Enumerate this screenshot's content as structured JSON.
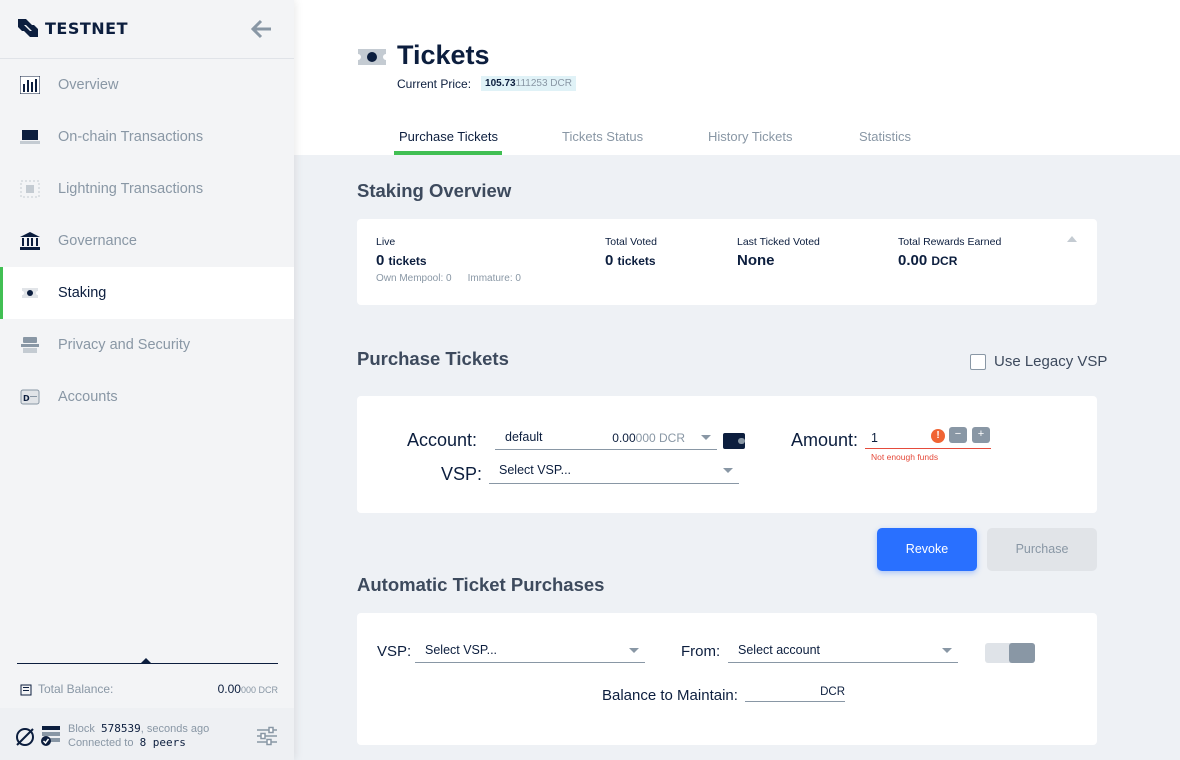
{
  "app": {
    "brand": "TESTNET"
  },
  "sidebar": {
    "items": [
      {
        "label": "Overview",
        "icon": "overview-icon"
      },
      {
        "label": "On-chain Transactions",
        "icon": "transactions-icon"
      },
      {
        "label": "Lightning Transactions",
        "icon": "lightning-icon"
      },
      {
        "label": "Governance",
        "icon": "governance-icon"
      },
      {
        "label": "Staking",
        "icon": "staking-icon",
        "active": true
      },
      {
        "label": "Privacy and Security",
        "icon": "privacy-icon"
      },
      {
        "label": "Accounts",
        "icon": "accounts-icon"
      }
    ],
    "total_balance_label": "Total Balance:",
    "total_balance_main": "0.00",
    "total_balance_small": "000 DCR",
    "footer": {
      "block_label": "Block",
      "block_number": "578539",
      "block_time": ", seconds ago",
      "connected_label": "Connected to",
      "peers": "8 peers"
    }
  },
  "header": {
    "title": "Tickets",
    "price_label": "Current Price:",
    "price_main": "105.73",
    "price_dim": "111253 DCR",
    "tabs": [
      "Purchase Tickets",
      "Tickets Status",
      "History Tickets",
      "Statistics"
    ],
    "active_tab": 0
  },
  "staking_overview": {
    "title": "Staking Overview",
    "live_label": "Live",
    "live_value": "0",
    "live_unit": "tickets",
    "own_mempool": "Own Mempool: 0",
    "immature": "Immature: 0",
    "total_voted_label": "Total Voted",
    "total_voted_value": "0",
    "total_voted_unit": "tickets",
    "last_voted_label": "Last Ticked Voted",
    "last_voted_value": "None",
    "rewards_label": "Total Rewards Earned",
    "rewards_value": "0.00",
    "rewards_unit": "DCR"
  },
  "purchase": {
    "title": "Purchase Tickets",
    "legacy_label": "Use Legacy VSP",
    "account_label": "Account:",
    "account_value": "default",
    "account_balance_main": "0.00",
    "account_balance_dim": "000 DCR",
    "vsp_label": "VSP:",
    "vsp_placeholder": "Select VSP...",
    "amount_label": "Amount:",
    "amount_value": "1",
    "error_text": "Not enough funds",
    "minus": "−",
    "plus": "+",
    "revoke_label": "Revoke",
    "purchase_label": "Purchase"
  },
  "auto": {
    "title": "Automatic Ticket Purchases",
    "vsp_label": "VSP:",
    "vsp_placeholder": "Select VSP...",
    "from_label": "From:",
    "from_placeholder": "Select account",
    "balance_label": "Balance to Maintain:",
    "balance_unit": "DCR"
  },
  "colors": {
    "accent_green": "#41bf53",
    "primary_blue": "#2970ff",
    "error": "#e54b3c"
  }
}
